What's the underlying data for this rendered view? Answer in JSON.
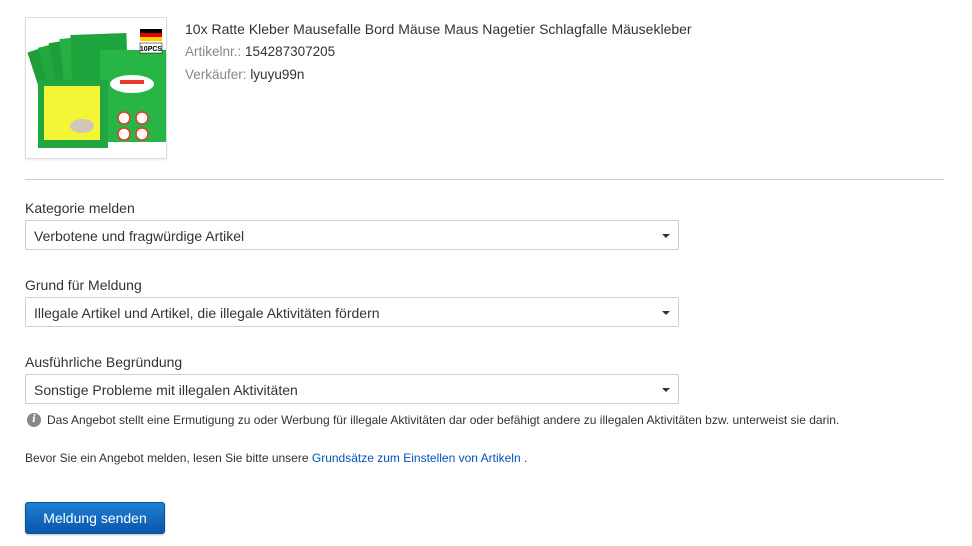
{
  "product": {
    "title": "10x Ratte Kleber Mausefalle Bord Mäuse Maus Nagetier Schlagfalle Mäusekleber",
    "article_label": "Artikelnr.:",
    "article_number": "154287307205",
    "seller_label": "Verkäufer:",
    "seller_name": "lyuyu99n",
    "image_badge": "10PCS"
  },
  "form": {
    "category": {
      "label": "Kategorie melden",
      "value": "Verbotene und fragwürdige Artikel"
    },
    "reason": {
      "label": "Grund für Meldung",
      "value": "Illegale Artikel und Artikel, die illegale Aktivitäten fördern"
    },
    "detail": {
      "label": "Ausführliche Begründung",
      "value": "Sonstige Probleme mit illegalen Aktivitäten"
    },
    "info_text": "Das Angebot stellt eine Ermutigung zu oder Werbung für illegale Aktivitäten dar oder befähigt andere zu illegalen Aktivitäten bzw. unterweist sie darin.",
    "notice_prefix": "Bevor Sie ein Angebot melden, lesen Sie bitte unsere",
    "notice_link": "Grundsätze zum Einstellen von Artikeln",
    "notice_suffix": ".",
    "submit_label": "Meldung senden"
  },
  "colors": {
    "link": "#0654ba",
    "button": "#0a63c0",
    "divider": "#cccccc"
  }
}
